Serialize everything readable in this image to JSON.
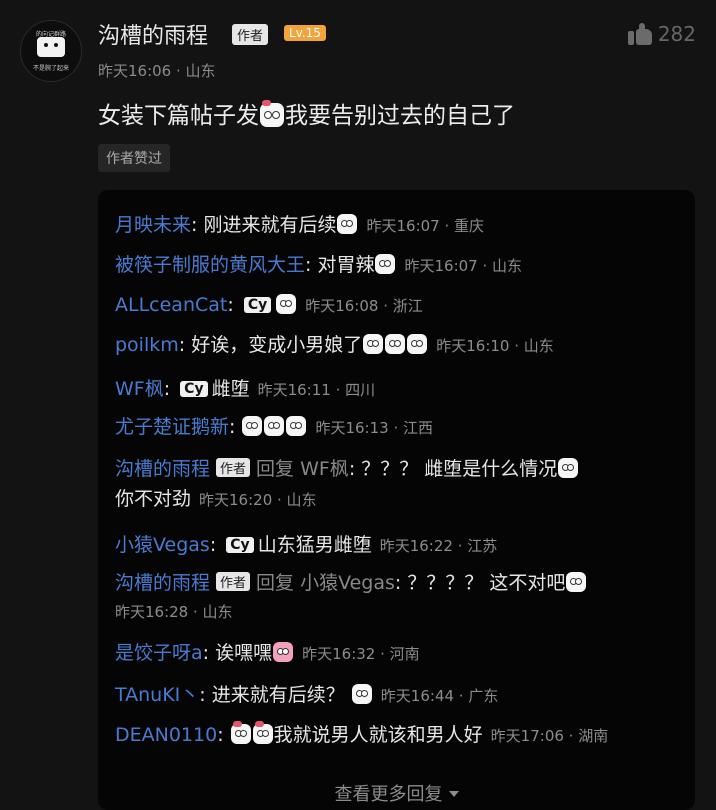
{
  "post": {
    "avatar_top_text": "的向记群路",
    "avatar_bottom_text": "不是腕了起来",
    "author_name": "沟槽的雨程",
    "author_badge": "作者",
    "level_badge": "Lv.15",
    "like_count": "282",
    "meta": "昨天16:06 · 山东",
    "content_before": "女装下篇帖子发",
    "content_after": "我要告别过去的自己了",
    "liked_tag": "作者赞过"
  },
  "replies": [
    {
      "name": "月映未来",
      "text": "刚进来就有后续",
      "meta": "昨天16:07 · 重庆"
    },
    {
      "name": "被筷子制服的黄风大王",
      "text": "对胃辣",
      "meta": "昨天16:07 · 山东"
    },
    {
      "name": "ALLceanCat",
      "badge": "Cy",
      "meta": "昨天16:08 · 浙江"
    },
    {
      "name": "poilkm",
      "text": "好诶，变成小男娘了",
      "meta": "昨天16:10 · 山东"
    },
    {
      "name": "WF枫",
      "badge": "Cy",
      "text": "雌堕",
      "meta": "昨天16:11 · 四川"
    },
    {
      "name": "尤子楚证鹅新",
      "meta": "昨天16:13 · 江西"
    },
    {
      "name": "沟槽的雨程",
      "tag": "作者",
      "reply_word": "回复",
      "target": "WF枫",
      "text": "？？？ 雌堕是什么情况",
      "text2": "你不对劲",
      "meta": "昨天16:20 · 山东"
    },
    {
      "name": "小猿Vegas",
      "badge": "Cy",
      "text": "山东猛男雌堕",
      "meta": "昨天16:22 · 江苏"
    },
    {
      "name": "沟槽的雨程",
      "tag": "作者",
      "reply_word": "回复",
      "target": "小猿Vegas",
      "text": "？？？？ 这不对吧",
      "meta": "昨天16:28 · 山东"
    },
    {
      "name": "是饺子呀a",
      "text": "诶嘿嘿",
      "meta": "昨天16:32 · 河南"
    },
    {
      "name": "TAnuKI丶",
      "text": "进来就有后续？",
      "meta": "昨天16:44 · 广东"
    },
    {
      "name": "DEAN0110",
      "text": "我就说男人就该和男人好",
      "meta": "昨天17:06 · 湖南"
    }
  ],
  "more_replies": "查看更多回复"
}
